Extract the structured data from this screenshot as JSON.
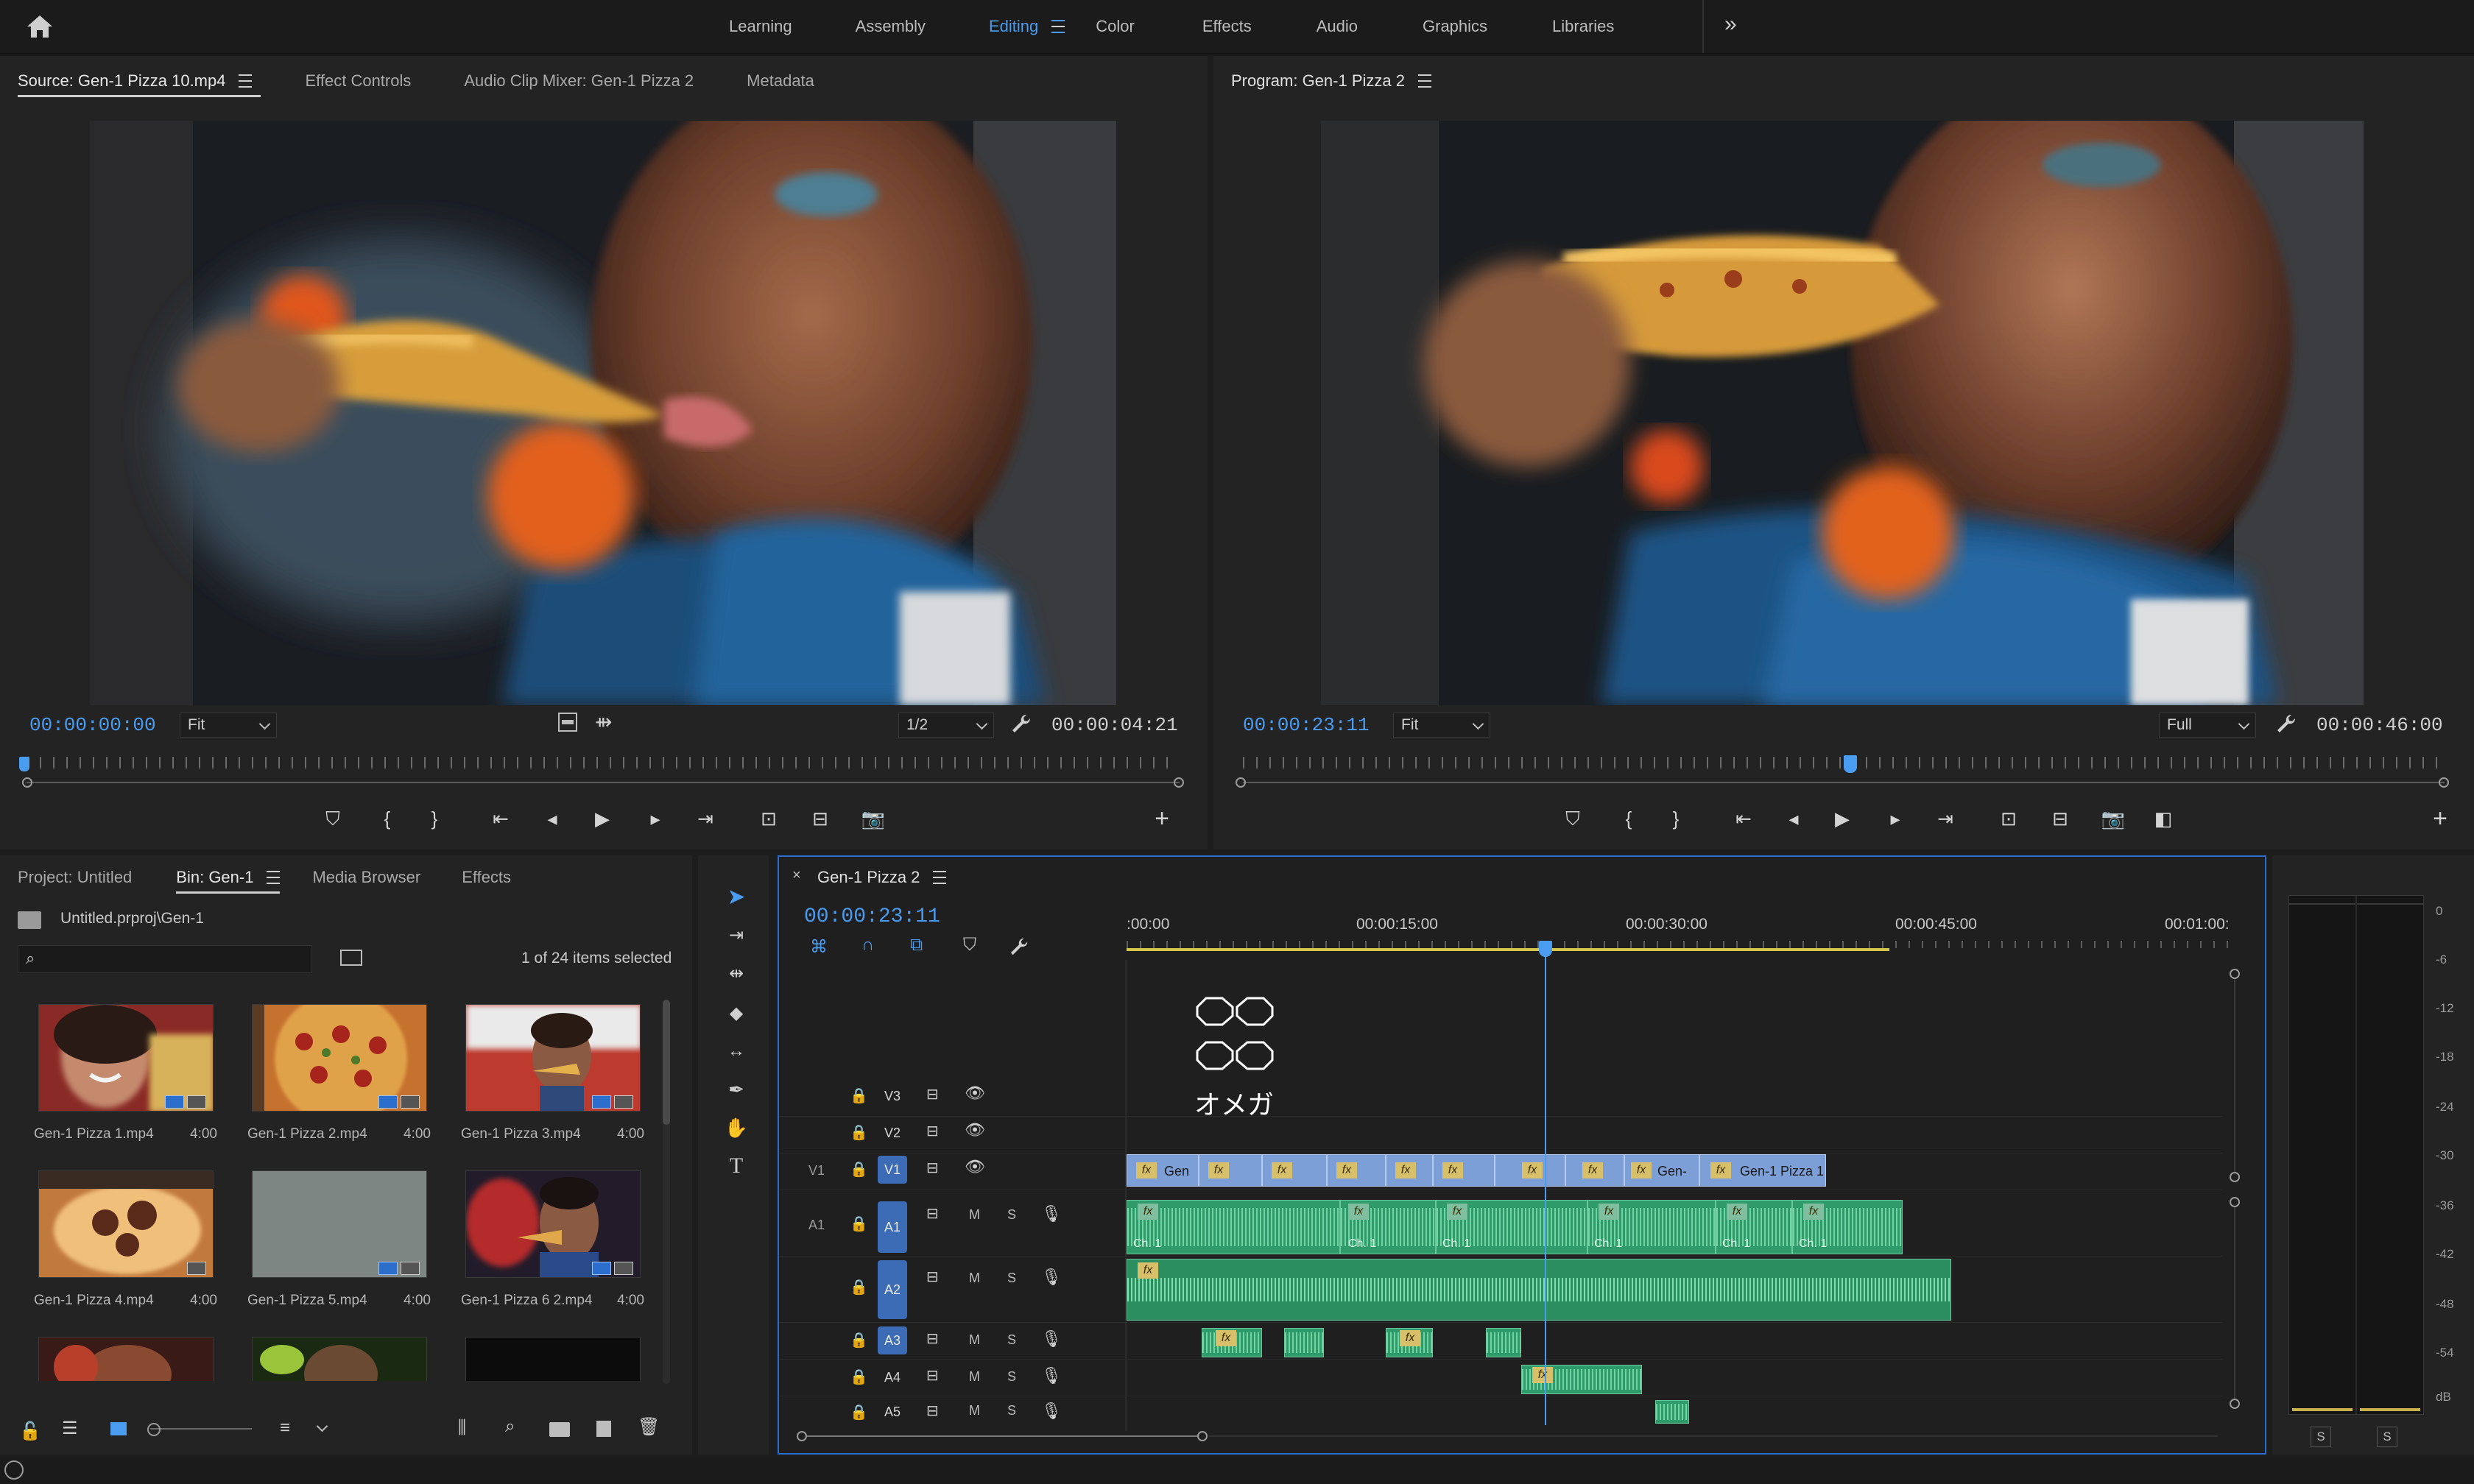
{
  "workspaces": {
    "items": [
      "Learning",
      "Assembly",
      "Editing",
      "Color",
      "Effects",
      "Audio",
      "Graphics",
      "Libraries"
    ],
    "active": "Editing",
    "overflow": "»"
  },
  "source_panel": {
    "tabs": [
      "Source: Gen-1 Pizza 10.mp4",
      "Effect Controls",
      "Audio Clip Mixer: Gen-1 Pizza 2",
      "Metadata"
    ],
    "timecode": "00:00:00:00",
    "zoom": "Fit",
    "resolution": "1/2",
    "duration": "00:00:04:21"
  },
  "program_panel": {
    "tab": "Program: Gen-1 Pizza 2",
    "timecode": "00:00:23:11",
    "zoom": "Fit",
    "resolution": "Full",
    "duration": "00:00:46:00"
  },
  "project_panel": {
    "tabs": [
      "Project: Untitled",
      "Bin: Gen-1",
      "Media Browser",
      "Effects"
    ],
    "path": "Untitled.prproj\\Gen-1",
    "selection_count": "1 of 24 items selected",
    "items": [
      {
        "name": "Gen-1 Pizza 1.mp4",
        "duration": "4:00"
      },
      {
        "name": "Gen-1 Pizza 2.mp4",
        "duration": "4:00"
      },
      {
        "name": "Gen-1 Pizza 3.mp4",
        "duration": "4:00"
      },
      {
        "name": "Gen-1 Pizza 4.mp4",
        "duration": "4:00"
      },
      {
        "name": "Gen-1 Pizza 5.mp4",
        "duration": "4:00"
      },
      {
        "name": "Gen-1 Pizza 6 2.mp4",
        "duration": "4:00"
      }
    ]
  },
  "timeline": {
    "sequence_tab": "Gen-1 Pizza 2",
    "timecode": "00:00:23:11",
    "ruler_labels": [
      ":00:00",
      "00:00:15:00",
      "00:00:30:00",
      "00:00:45:00",
      "00:01:00:"
    ],
    "overlay_text": "オメガ",
    "tracks": {
      "video": [
        {
          "source": "",
          "target": "V3"
        },
        {
          "source": "",
          "target": "V2"
        },
        {
          "source": "V1",
          "target": "V1"
        }
      ],
      "audio": [
        {
          "source": "A1",
          "target": "A1"
        },
        {
          "source": "",
          "target": "A2"
        },
        {
          "source": "",
          "target": "A3"
        },
        {
          "source": "",
          "target": "A4"
        },
        {
          "source": "",
          "target": "A5"
        }
      ],
      "mute_label": "M",
      "solo_label": "S"
    },
    "clip_labels": {
      "v1_first": "Gen",
      "v1_mid": "Gen-",
      "v1_last": "Gen-1 Pizza 1",
      "fx": "fx",
      "channel": "Ch. 1"
    }
  },
  "audio_meter": {
    "scale": [
      "0",
      "-6",
      "-12",
      "-18",
      "-24",
      "-30",
      "-36",
      "-42",
      "-48",
      "-54",
      "dB"
    ],
    "solo_buttons": [
      "S",
      "S"
    ]
  }
}
